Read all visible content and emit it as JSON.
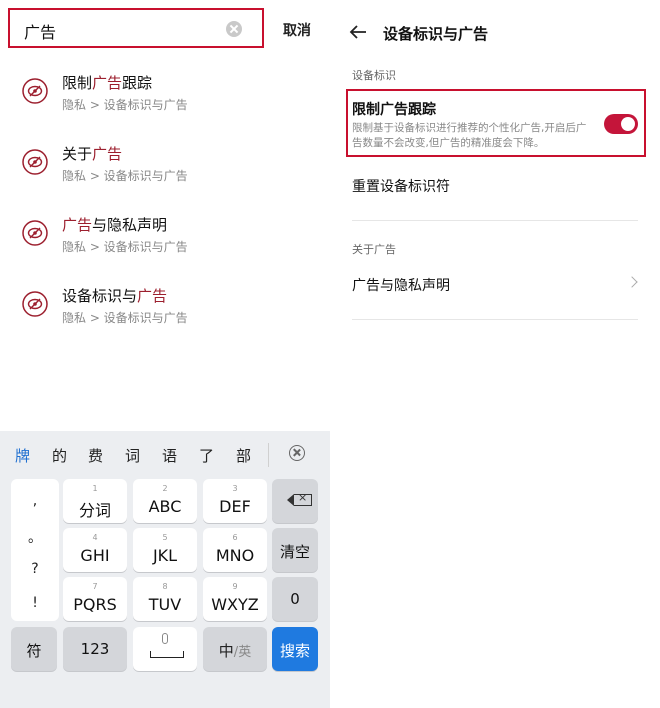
{
  "search": {
    "query": "广告",
    "cancel_label": "取消"
  },
  "results": [
    {
      "title_parts": [
        {
          "text": "限制",
          "hl": false
        },
        {
          "text": "广告",
          "hl": true
        },
        {
          "text": "跟踪",
          "hl": false
        }
      ],
      "path": "隐私 > 设备标识与广告"
    },
    {
      "title_parts": [
        {
          "text": "关于",
          "hl": false
        },
        {
          "text": "广告",
          "hl": true
        }
      ],
      "path": "隐私 > 设备标识与广告"
    },
    {
      "title_parts": [
        {
          "text": "广告",
          "hl": true
        },
        {
          "text": "与隐私声明",
          "hl": false
        }
      ],
      "path": "隐私 > 设备标识与广告"
    },
    {
      "title_parts": [
        {
          "text": "设备标识与",
          "hl": false
        },
        {
          "text": "广告",
          "hl": true
        }
      ],
      "path": "隐私 > 设备标识与广告"
    }
  ],
  "keyboard": {
    "candidates": [
      "牌",
      "的",
      "费",
      "词",
      "语",
      "了",
      "部"
    ],
    "punctuation": [
      ",",
      "。",
      "?",
      "!"
    ],
    "keys": {
      "k1": {
        "num": "1",
        "label": "分词"
      },
      "k2": {
        "num": "2",
        "label": "ABC"
      },
      "k3": {
        "num": "3",
        "label": "DEF"
      },
      "k4": {
        "num": "4",
        "label": "GHI"
      },
      "k5": {
        "num": "5",
        "label": "JKL"
      },
      "k6": {
        "num": "6",
        "label": "MNO"
      },
      "k7": {
        "num": "7",
        "label": "PQRS"
      },
      "k8": {
        "num": "8",
        "label": "TUV"
      },
      "k9": {
        "num": "9",
        "label": "WXYZ"
      },
      "clear": "清空",
      "zero": "0",
      "symbol": "符",
      "num_mode": "123",
      "lang_zh": "中",
      "lang_sep": "/",
      "lang_en": "英",
      "search": "搜索"
    }
  },
  "settings": {
    "title": "设备标识与广告",
    "section1": "设备标识",
    "limit_title": "限制广告跟踪",
    "limit_desc": "限制基于设备标识进行推荐的个性化广告,开启后广告数量不会改变,但广告的精准度会下降。",
    "limit_enabled": true,
    "reset_label": "重置设备标识符",
    "section2": "关于广告",
    "privacy_label": "广告与隐私声明"
  },
  "colors": {
    "accent": "#c8102e",
    "toggle_on": "#c4153a",
    "highlight_text": "#9c1f2e",
    "key_blue": "#1f7ae0"
  }
}
